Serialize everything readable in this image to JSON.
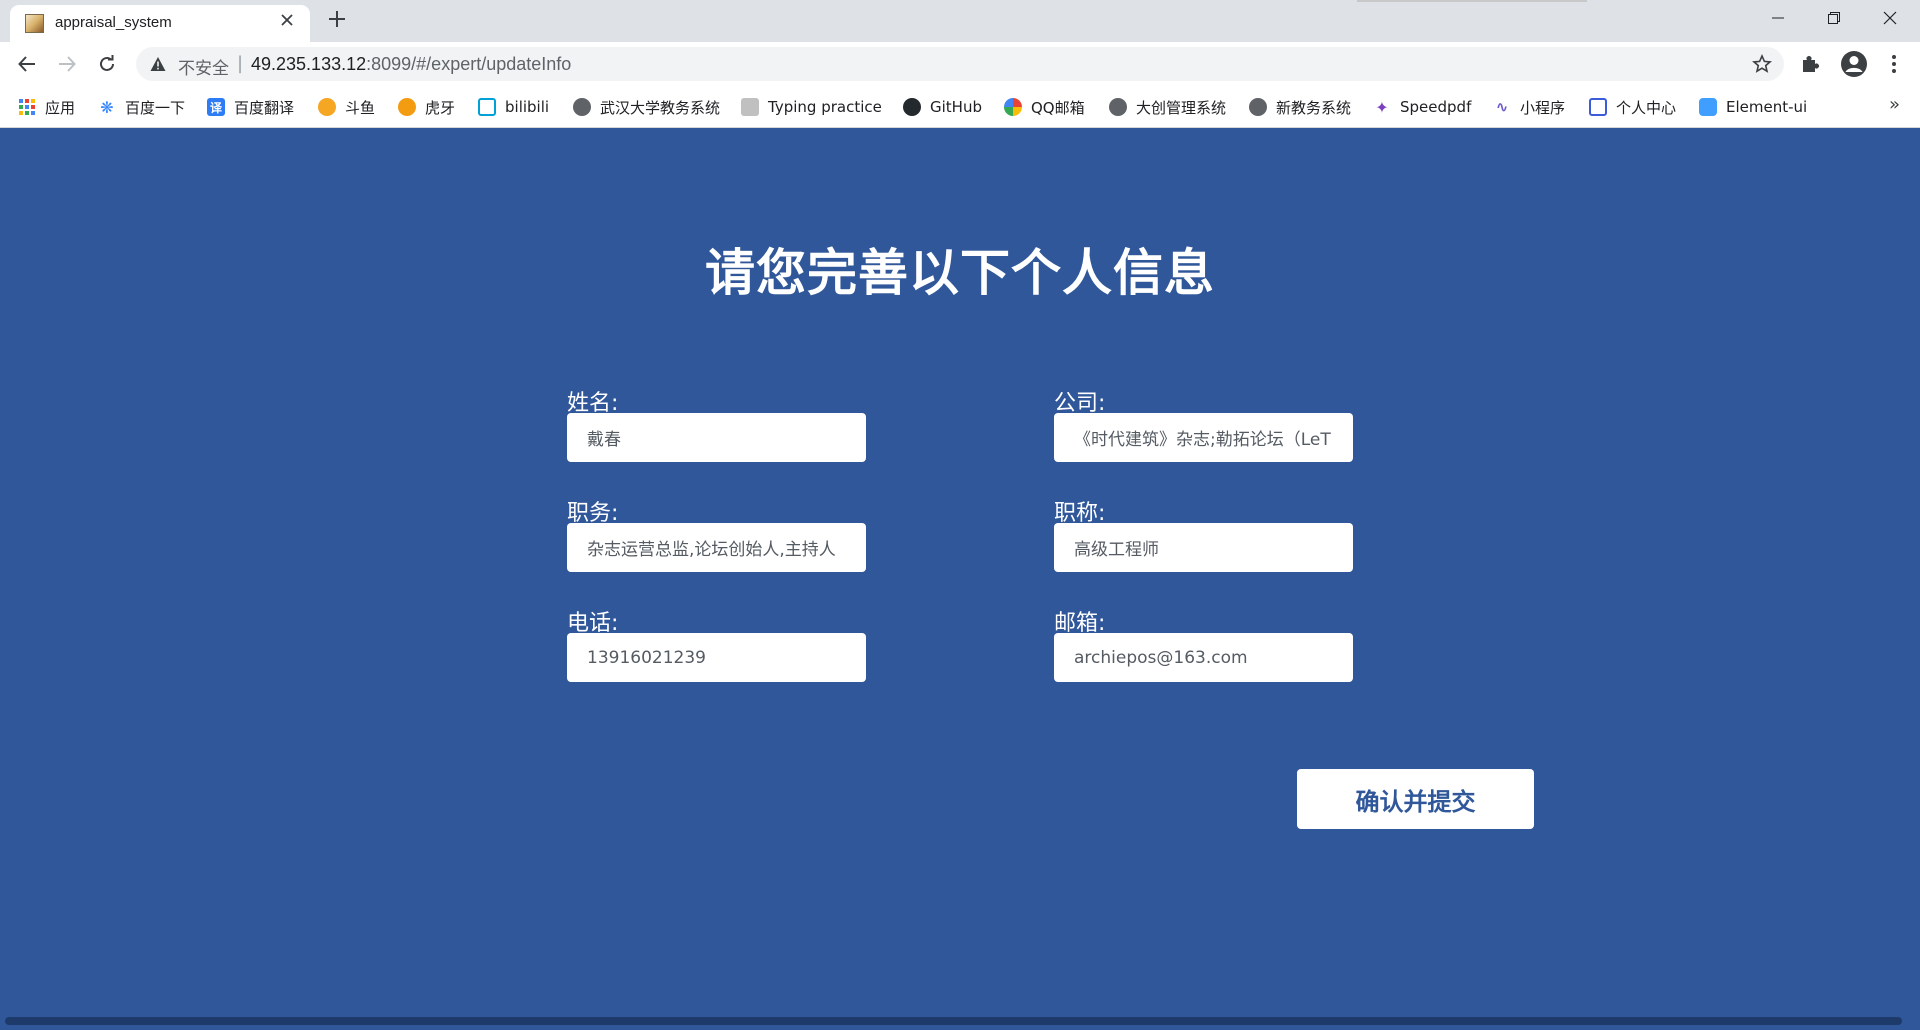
{
  "browser": {
    "tab_title": "appraisal_system",
    "insecure_label": "不安全",
    "url_host": "49.235.133.12",
    "url_rest": ":8099/#/expert/updateInfo",
    "more_bookmarks": "»"
  },
  "bookmarks": [
    {
      "label": "应用",
      "icon": "apps-grid-icon"
    },
    {
      "label": "百度一下",
      "icon": "baidu-paw-icon"
    },
    {
      "label": "百度翻译",
      "icon": "baidu-translate-icon"
    },
    {
      "label": "斗鱼",
      "icon": "douyu-icon"
    },
    {
      "label": "虎牙",
      "icon": "huya-icon"
    },
    {
      "label": "bilibili",
      "icon": "bilibili-icon"
    },
    {
      "label": "武汉大学教务系统",
      "icon": "globe-icon"
    },
    {
      "label": "Typing practice",
      "icon": "typing-practice-icon"
    },
    {
      "label": "GitHub",
      "icon": "github-icon"
    },
    {
      "label": "QQ邮箱",
      "icon": "qq-mail-icon"
    },
    {
      "label": "大创管理系统",
      "icon": "globe-icon"
    },
    {
      "label": "新教务系统",
      "icon": "globe-icon"
    },
    {
      "label": "Speedpdf",
      "icon": "speedpdf-icon"
    },
    {
      "label": "小程序",
      "icon": "miniprogram-icon"
    },
    {
      "label": "个人中心",
      "icon": "personal-center-icon"
    },
    {
      "label": "Element-ui",
      "icon": "element-ui-icon"
    }
  ],
  "form": {
    "title": "请您完善以下个人信息",
    "name": {
      "label": "姓名:",
      "value": "戴春"
    },
    "company": {
      "label": "公司:",
      "value": "《时代建筑》杂志;勒拓论坛（LeT"
    },
    "position": {
      "label": "职务:",
      "value": "杂志运营总监,论坛创始人,主持人"
    },
    "title_rank": {
      "label": "职称:",
      "value": "高级工程师"
    },
    "phone": {
      "label": "电话:",
      "value": "13916021239"
    },
    "email": {
      "label": "邮箱:",
      "value": "archiepos@163.com"
    },
    "submit_label": "确认并提交"
  },
  "colors": {
    "background": "#30579a",
    "button_text": "#30579a"
  }
}
